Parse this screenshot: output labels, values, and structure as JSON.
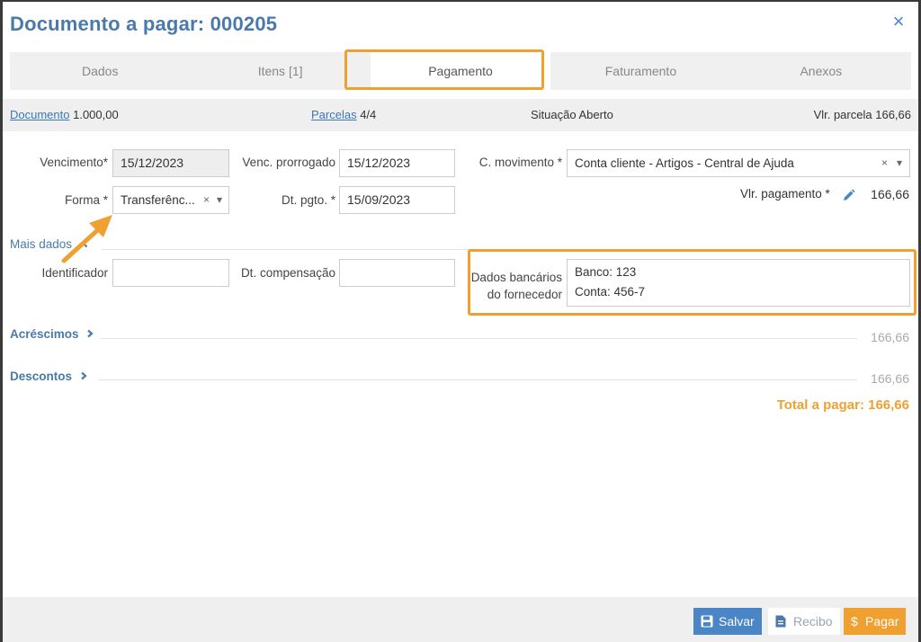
{
  "dialog": {
    "title": "Documento a pagar: 000205",
    "close_glyph": "×"
  },
  "tabs": [
    {
      "label": "Dados"
    },
    {
      "label": "Itens [1]"
    },
    {
      "label": "Pagamento",
      "active": true
    },
    {
      "label": "Faturamento"
    },
    {
      "label": "Anexos"
    }
  ],
  "summary": {
    "documento_link": "Documento",
    "documento_value": "1.000,00",
    "parcelas_link": "Parcelas",
    "parcelas_value": "4/4",
    "situacao_label": "Situação",
    "situacao_value": "Aberto",
    "vlr_parcela_label": "Vlr. parcela",
    "vlr_parcela_value": "166,66"
  },
  "form": {
    "vencimento_label": "Vencimento*",
    "vencimento_value": "15/12/2023",
    "venc_prorrogado_label": "Venc. prorrogado",
    "venc_prorrogado_value": "15/12/2023",
    "c_movimento_label": "C. movimento *",
    "c_movimento_value": "Conta cliente - Artigos - Central de Ajuda",
    "forma_label": "Forma *",
    "forma_value": "Transferênc...",
    "dt_pgto_label": "Dt. pgto. *",
    "dt_pgto_value": "15/09/2023",
    "vlr_pagamento_label": "Vlr. pagamento *",
    "vlr_pagamento_value": "166,66"
  },
  "mais_dados": {
    "title": "Mais dados",
    "identificador_label": "Identificador",
    "identificador_value": "",
    "dt_compensacao_label": "Dt. compensação",
    "dt_compensacao_value": "",
    "dados_bancarios_label_1": "Dados bancários",
    "dados_bancarios_label_2": "do fornecedor",
    "dados_bancarios_line_1": "Banco: 123",
    "dados_bancarios_line_2": "Conta: 456-7"
  },
  "acrescimos": {
    "label": "Acréscimos",
    "value": "166,66"
  },
  "descontos": {
    "label": "Descontos",
    "value": "166,66"
  },
  "total": {
    "label": "Total a pagar: 166,66"
  },
  "footer": {
    "salvar_label": "Salvar",
    "recibo_label": "Recibo",
    "pagar_label": "Pagar",
    "pagar_icon_glyph": "$"
  },
  "colors": {
    "accent_blue": "#4a7aab",
    "highlight_orange": "#f0a030",
    "salvar_bg": "#4a86c5",
    "pagar_bg": "#f0a030"
  },
  "icons": {
    "close": "close-icon",
    "pencil": "pencil-icon",
    "chevron_up": "chevron-up-icon",
    "chevron_right": "chevron-right-icon",
    "save": "floppy-icon",
    "receipt": "document-icon",
    "dollar": "dollar-icon"
  }
}
